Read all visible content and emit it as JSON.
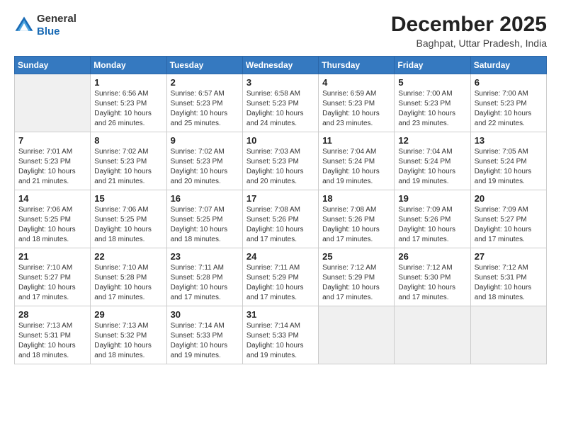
{
  "logo": {
    "general": "General",
    "blue": "Blue"
  },
  "header": {
    "month_year": "December 2025",
    "location": "Baghpat, Uttar Pradesh, India"
  },
  "weekdays": [
    "Sunday",
    "Monday",
    "Tuesday",
    "Wednesday",
    "Thursday",
    "Friday",
    "Saturday"
  ],
  "weeks": [
    [
      {
        "day": "",
        "info": ""
      },
      {
        "day": "1",
        "info": "Sunrise: 6:56 AM\nSunset: 5:23 PM\nDaylight: 10 hours\nand 26 minutes."
      },
      {
        "day": "2",
        "info": "Sunrise: 6:57 AM\nSunset: 5:23 PM\nDaylight: 10 hours\nand 25 minutes."
      },
      {
        "day": "3",
        "info": "Sunrise: 6:58 AM\nSunset: 5:23 PM\nDaylight: 10 hours\nand 24 minutes."
      },
      {
        "day": "4",
        "info": "Sunrise: 6:59 AM\nSunset: 5:23 PM\nDaylight: 10 hours\nand 23 minutes."
      },
      {
        "day": "5",
        "info": "Sunrise: 7:00 AM\nSunset: 5:23 PM\nDaylight: 10 hours\nand 23 minutes."
      },
      {
        "day": "6",
        "info": "Sunrise: 7:00 AM\nSunset: 5:23 PM\nDaylight: 10 hours\nand 22 minutes."
      }
    ],
    [
      {
        "day": "7",
        "info": "Sunrise: 7:01 AM\nSunset: 5:23 PM\nDaylight: 10 hours\nand 21 minutes."
      },
      {
        "day": "8",
        "info": "Sunrise: 7:02 AM\nSunset: 5:23 PM\nDaylight: 10 hours\nand 21 minutes."
      },
      {
        "day": "9",
        "info": "Sunrise: 7:02 AM\nSunset: 5:23 PM\nDaylight: 10 hours\nand 20 minutes."
      },
      {
        "day": "10",
        "info": "Sunrise: 7:03 AM\nSunset: 5:23 PM\nDaylight: 10 hours\nand 20 minutes."
      },
      {
        "day": "11",
        "info": "Sunrise: 7:04 AM\nSunset: 5:24 PM\nDaylight: 10 hours\nand 19 minutes."
      },
      {
        "day": "12",
        "info": "Sunrise: 7:04 AM\nSunset: 5:24 PM\nDaylight: 10 hours\nand 19 minutes."
      },
      {
        "day": "13",
        "info": "Sunrise: 7:05 AM\nSunset: 5:24 PM\nDaylight: 10 hours\nand 19 minutes."
      }
    ],
    [
      {
        "day": "14",
        "info": "Sunrise: 7:06 AM\nSunset: 5:25 PM\nDaylight: 10 hours\nand 18 minutes."
      },
      {
        "day": "15",
        "info": "Sunrise: 7:06 AM\nSunset: 5:25 PM\nDaylight: 10 hours\nand 18 minutes."
      },
      {
        "day": "16",
        "info": "Sunrise: 7:07 AM\nSunset: 5:25 PM\nDaylight: 10 hours\nand 18 minutes."
      },
      {
        "day": "17",
        "info": "Sunrise: 7:08 AM\nSunset: 5:26 PM\nDaylight: 10 hours\nand 17 minutes."
      },
      {
        "day": "18",
        "info": "Sunrise: 7:08 AM\nSunset: 5:26 PM\nDaylight: 10 hours\nand 17 minutes."
      },
      {
        "day": "19",
        "info": "Sunrise: 7:09 AM\nSunset: 5:26 PM\nDaylight: 10 hours\nand 17 minutes."
      },
      {
        "day": "20",
        "info": "Sunrise: 7:09 AM\nSunset: 5:27 PM\nDaylight: 10 hours\nand 17 minutes."
      }
    ],
    [
      {
        "day": "21",
        "info": "Sunrise: 7:10 AM\nSunset: 5:27 PM\nDaylight: 10 hours\nand 17 minutes."
      },
      {
        "day": "22",
        "info": "Sunrise: 7:10 AM\nSunset: 5:28 PM\nDaylight: 10 hours\nand 17 minutes."
      },
      {
        "day": "23",
        "info": "Sunrise: 7:11 AM\nSunset: 5:28 PM\nDaylight: 10 hours\nand 17 minutes."
      },
      {
        "day": "24",
        "info": "Sunrise: 7:11 AM\nSunset: 5:29 PM\nDaylight: 10 hours\nand 17 minutes."
      },
      {
        "day": "25",
        "info": "Sunrise: 7:12 AM\nSunset: 5:29 PM\nDaylight: 10 hours\nand 17 minutes."
      },
      {
        "day": "26",
        "info": "Sunrise: 7:12 AM\nSunset: 5:30 PM\nDaylight: 10 hours\nand 17 minutes."
      },
      {
        "day": "27",
        "info": "Sunrise: 7:12 AM\nSunset: 5:31 PM\nDaylight: 10 hours\nand 18 minutes."
      }
    ],
    [
      {
        "day": "28",
        "info": "Sunrise: 7:13 AM\nSunset: 5:31 PM\nDaylight: 10 hours\nand 18 minutes."
      },
      {
        "day": "29",
        "info": "Sunrise: 7:13 AM\nSunset: 5:32 PM\nDaylight: 10 hours\nand 18 minutes."
      },
      {
        "day": "30",
        "info": "Sunrise: 7:14 AM\nSunset: 5:33 PM\nDaylight: 10 hours\nand 19 minutes."
      },
      {
        "day": "31",
        "info": "Sunrise: 7:14 AM\nSunset: 5:33 PM\nDaylight: 10 hours\nand 19 minutes."
      },
      {
        "day": "",
        "info": ""
      },
      {
        "day": "",
        "info": ""
      },
      {
        "day": "",
        "info": ""
      }
    ]
  ]
}
